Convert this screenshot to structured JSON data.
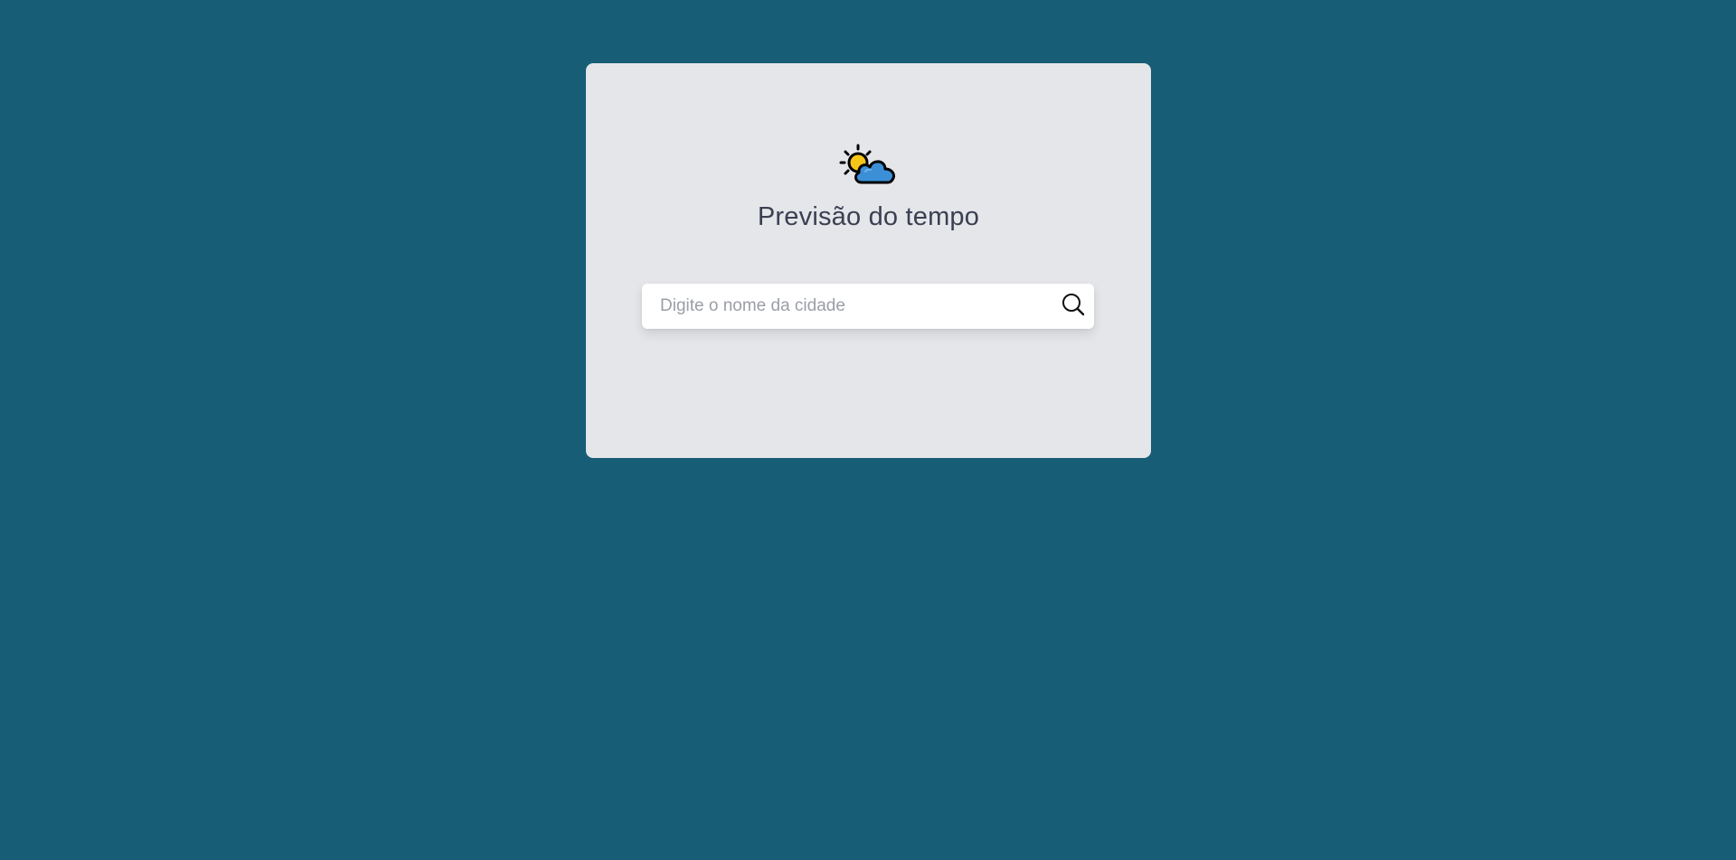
{
  "app": {
    "title": "Previsão do tempo",
    "logo_icon": "sun-behind-cloud-icon"
  },
  "search": {
    "placeholder": "Digite o nome da cidade",
    "value": "",
    "button_icon": "search-icon"
  },
  "colors": {
    "background": "#175d76",
    "card": "#e5e6ea",
    "title_text": "#3a3f51",
    "sun": "#f5c518",
    "cloud": "#3a8fd6"
  }
}
